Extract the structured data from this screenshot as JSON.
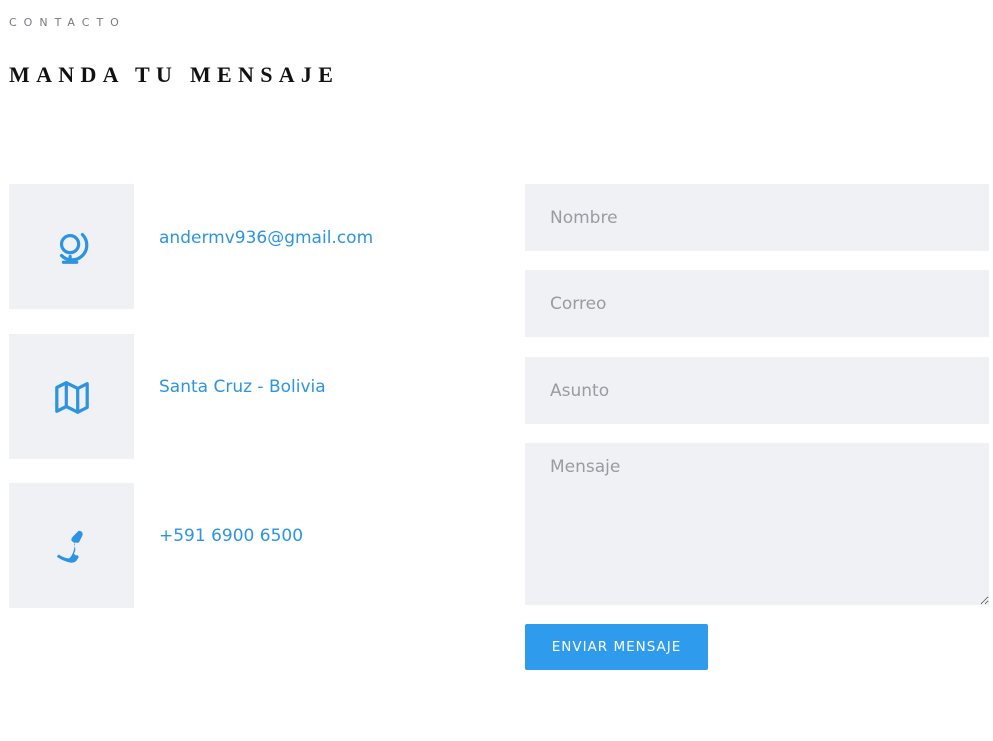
{
  "section": {
    "eyebrow": "CONTACTO",
    "title": "MANDA TU MENSAJE"
  },
  "contact_info": {
    "email": {
      "icon": "globe-icon",
      "text": "andermv936@gmail.com"
    },
    "location": {
      "icon": "map-icon",
      "text": "Santa Cruz - Bolivia"
    },
    "phone": {
      "icon": "phone-icon",
      "text": "+591 6900 6500"
    }
  },
  "form": {
    "name_placeholder": "Nombre",
    "email_placeholder": "Correo",
    "subject_placeholder": "Asunto",
    "message_placeholder": "Mensaje",
    "submit_label": "ENVIAR MENSAJE"
  },
  "colors": {
    "accent": "#2f9bec",
    "link": "#2d94e2",
    "panel": "#f0f1f5",
    "heading": "#111111"
  }
}
